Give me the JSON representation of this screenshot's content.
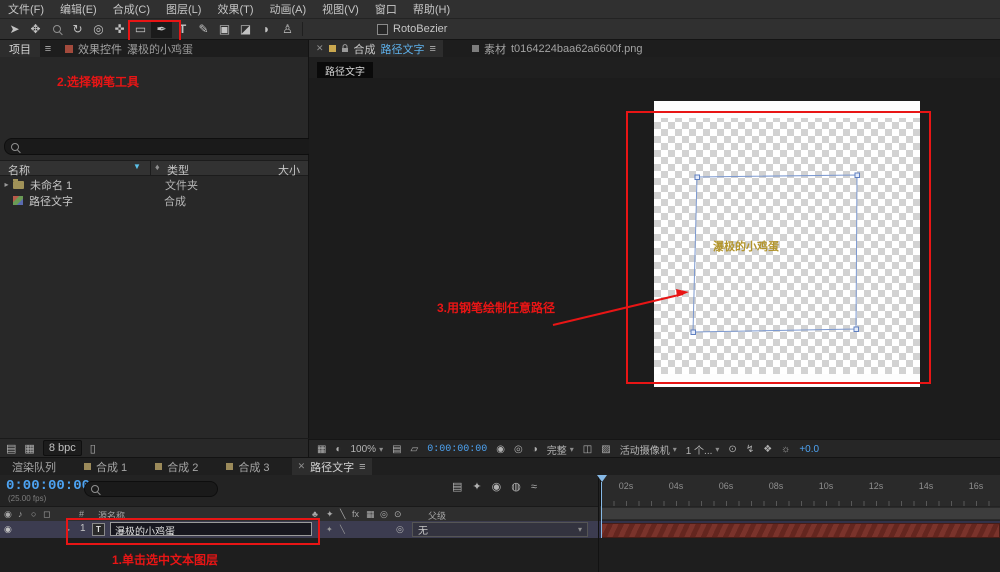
{
  "menu_bar": {
    "items": [
      "文件(F)",
      "编辑(E)",
      "合成(C)",
      "图层(L)",
      "效果(T)",
      "动画(A)",
      "视图(V)",
      "窗口",
      "帮助(H)"
    ]
  },
  "toolbar": {
    "rotobezier_label": "RotoBezier"
  },
  "left_panel": {
    "project_tab": "项目",
    "effect_controls_tab": "效果控件",
    "effect_controls_target": "瀑极的小鸡蛋",
    "columns": {
      "name": "名称",
      "type": "类型",
      "size": "大小"
    },
    "rows": [
      {
        "name": "未命名 1",
        "type": "文件夹"
      },
      {
        "name": "路径文字",
        "type": "合成"
      }
    ],
    "footer": {
      "bpc": "8 bpc"
    }
  },
  "viewer": {
    "comp_tab": {
      "label": "合成",
      "name": "路径文字"
    },
    "footage_tab": {
      "label": "素材",
      "name": "t0164224baa62a6600f.png"
    },
    "view_selector": "路径文字",
    "canvas_text": "瀑极的小鸡蛋",
    "controls": {
      "zoom": "100%",
      "timecode": "0:00:00:00",
      "resolution": "完整",
      "camera": "活动摄像机",
      "view_count": "1 个...",
      "exposure": "+0.0"
    }
  },
  "annotations": {
    "step1": "1.单击选中文本图层",
    "step2": "2.选择钢笔工具",
    "step3": "3.用钢笔绘制任意路径"
  },
  "timeline": {
    "tabs": [
      {
        "label": "渲染队列"
      },
      {
        "label": "合成 1"
      },
      {
        "label": "合成 2"
      },
      {
        "label": "合成 3"
      },
      {
        "label": "路径文字"
      }
    ],
    "timecode": "0:00:00:00",
    "fps_label": "(25.00 fps)",
    "columns": {
      "index": "#",
      "source_name": "源名称",
      "fx_label": "fx",
      "parent": "父级"
    },
    "layer": {
      "index": "1",
      "icon": "T",
      "name": "瀑极的小鸡蛋",
      "parent_value": "无"
    },
    "ruler": [
      "02s",
      "04s",
      "06s",
      "08s",
      "10s",
      "12s",
      "14s",
      "16s"
    ]
  }
}
